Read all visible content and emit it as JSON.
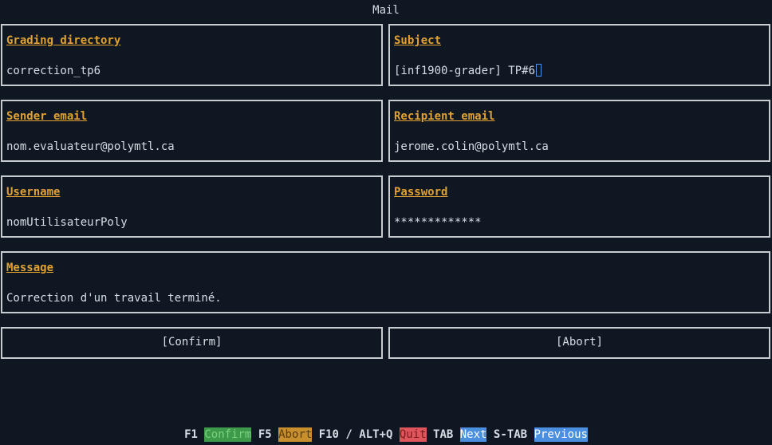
{
  "window": {
    "title": "Mail"
  },
  "fields": {
    "grading_directory": {
      "label": "Grading directory",
      "value": "correction_tp6"
    },
    "subject": {
      "label": "Subject",
      "value": "[inf1900-grader] TP#6"
    },
    "sender_email": {
      "label": "Sender email",
      "value": "nom.evaluateur@polymtl.ca"
    },
    "recipient_email": {
      "label": "Recipient email",
      "value": "jerome.colin@polymtl.ca"
    },
    "username": {
      "label": "Username",
      "value": "nomUtilisateurPoly"
    },
    "password": {
      "label": "Password",
      "value": "*************"
    },
    "message": {
      "label": "Message",
      "value": "Correction d'un travail terminé."
    }
  },
  "buttons": {
    "confirm": "[Confirm]",
    "abort": "[Abort]"
  },
  "footer": {
    "items": [
      {
        "key": "F1",
        "action": "Confirm",
        "color": "#3c9a4a"
      },
      {
        "key": "F5",
        "action": "Abort",
        "color": "#c98f2c"
      },
      {
        "key": "F10 / ALT+Q",
        "action": "Quit",
        "color": "#e0555c"
      },
      {
        "key": "TAB",
        "action": "Next",
        "color": "#4a8fe0"
      },
      {
        "key": "S-TAB",
        "action": "Previous",
        "color": "#4a8fe0"
      }
    ]
  }
}
